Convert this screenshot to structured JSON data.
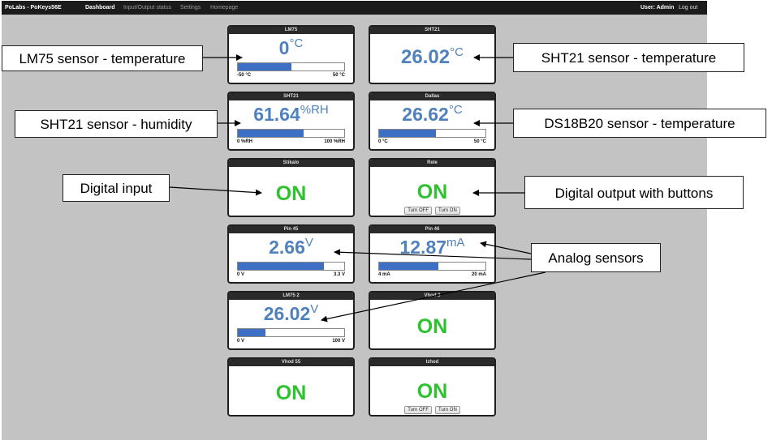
{
  "navbar": {
    "brand": "PoLabs - PoKeys56E",
    "items": [
      "Dashboard",
      "Input/Output status",
      "Settings",
      "Homepage"
    ],
    "user": "User: Admin",
    "logout": "Log out"
  },
  "widgets": {
    "lm75": {
      "title": "LM75",
      "value": "0",
      "unit": "°C",
      "min": "-50 °C",
      "max": "50 °C",
      "level": 0.5
    },
    "sht21_temp": {
      "title": "SHT21",
      "value": "26.02",
      "unit": "°C"
    },
    "sht21_hum": {
      "title": "SHT21",
      "value": "61.64",
      "unit": "%RH",
      "min": "0 %RH",
      "max": "100 %RH",
      "level": 0.6164
    },
    "dallas": {
      "title": "Dallas",
      "value": "26.62",
      "unit": "°C",
      "min": "0 °C",
      "max": "50 °C",
      "level": 0.532
    },
    "stikalo": {
      "title": "Stikalo",
      "state": "ON"
    },
    "rele": {
      "title": "Rele",
      "state": "ON",
      "off_label": "Turn OFF",
      "on_label": "Turn ON"
    },
    "pin45": {
      "title": "Pin 45",
      "value": "2.66",
      "unit": "V",
      "min": "0 V",
      "max": "3.3 V",
      "level": 0.806
    },
    "pin46": {
      "title": "Pin 46",
      "value": "12.87",
      "unit": "mA",
      "min": "4 mA",
      "max": "20 mA",
      "level": 0.554
    },
    "lm75_2": {
      "title": "LM75 2",
      "value": "26.02",
      "unit": "V",
      "min": "0 V",
      "max": "100 V",
      "level": 0.26
    },
    "vhod3": {
      "title": "Vhod 3",
      "state": "ON"
    },
    "vhod55": {
      "title": "Vhod 55",
      "state": "ON"
    },
    "izhod": {
      "title": "Izhod",
      "state": "ON",
      "off_label": "Turn OFF",
      "on_label": "Turn ON"
    }
  },
  "callouts": {
    "lm75": "LM75 sensor - temperature",
    "sht21_temp": "SHT21 sensor - temperature",
    "sht21_hum": "SHT21 sensor - humidity",
    "ds18b20": "DS18B20 sensor -  temperature",
    "digital_input": "Digital input",
    "digital_output": "Digital output with buttons",
    "analog": "Analog sensors"
  }
}
